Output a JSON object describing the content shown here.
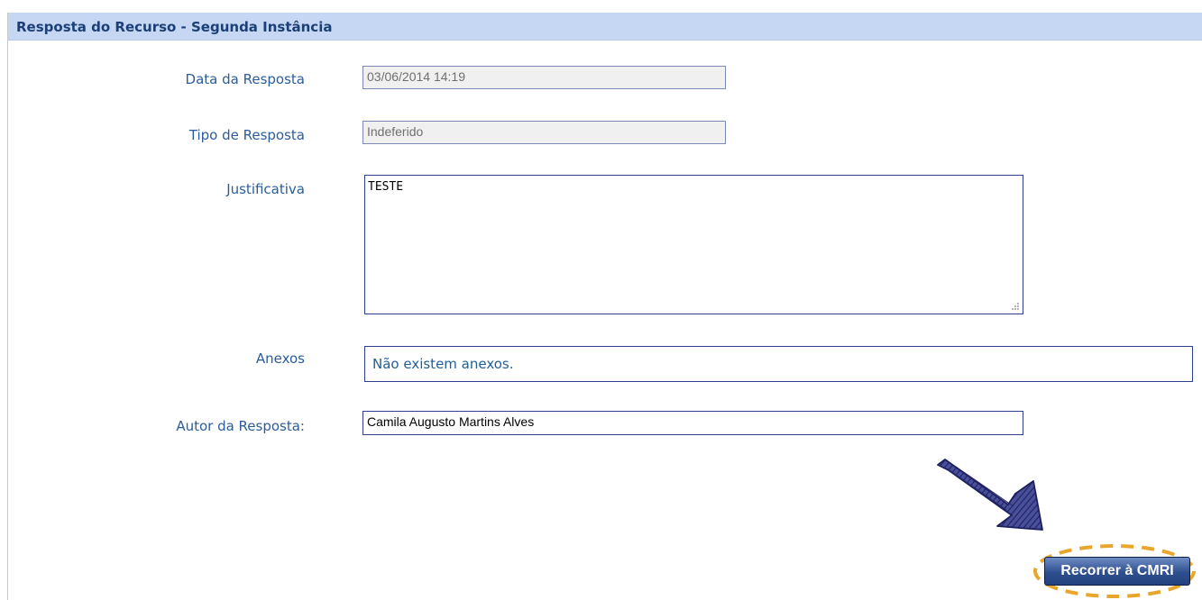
{
  "panel": {
    "title": "Resposta do Recurso - Segunda Instância"
  },
  "form": {
    "data_resposta": {
      "label": "Data da Resposta",
      "value": "03/06/2014 14:19"
    },
    "tipo_resposta": {
      "label": "Tipo de Resposta",
      "value": "Indeferido"
    },
    "justificativa": {
      "label": "Justificativa",
      "value": "TESTE"
    },
    "anexos": {
      "label": "Anexos",
      "value": "Não existem anexos."
    },
    "autor_resposta": {
      "label": "Autor da Resposta:",
      "value": "Camila Augusto Martins Alves"
    }
  },
  "actions": {
    "recorrer_label": "Recorrer à CMRI"
  },
  "annotations": {
    "arrow_color": "#2c2f7a",
    "highlight_color": "#e9a62d"
  },
  "colors": {
    "header_bg": "#c5d7f2",
    "header_text": "#1d3f78",
    "label_text": "#2a5d9a",
    "field_border": "#2f3f8f"
  }
}
